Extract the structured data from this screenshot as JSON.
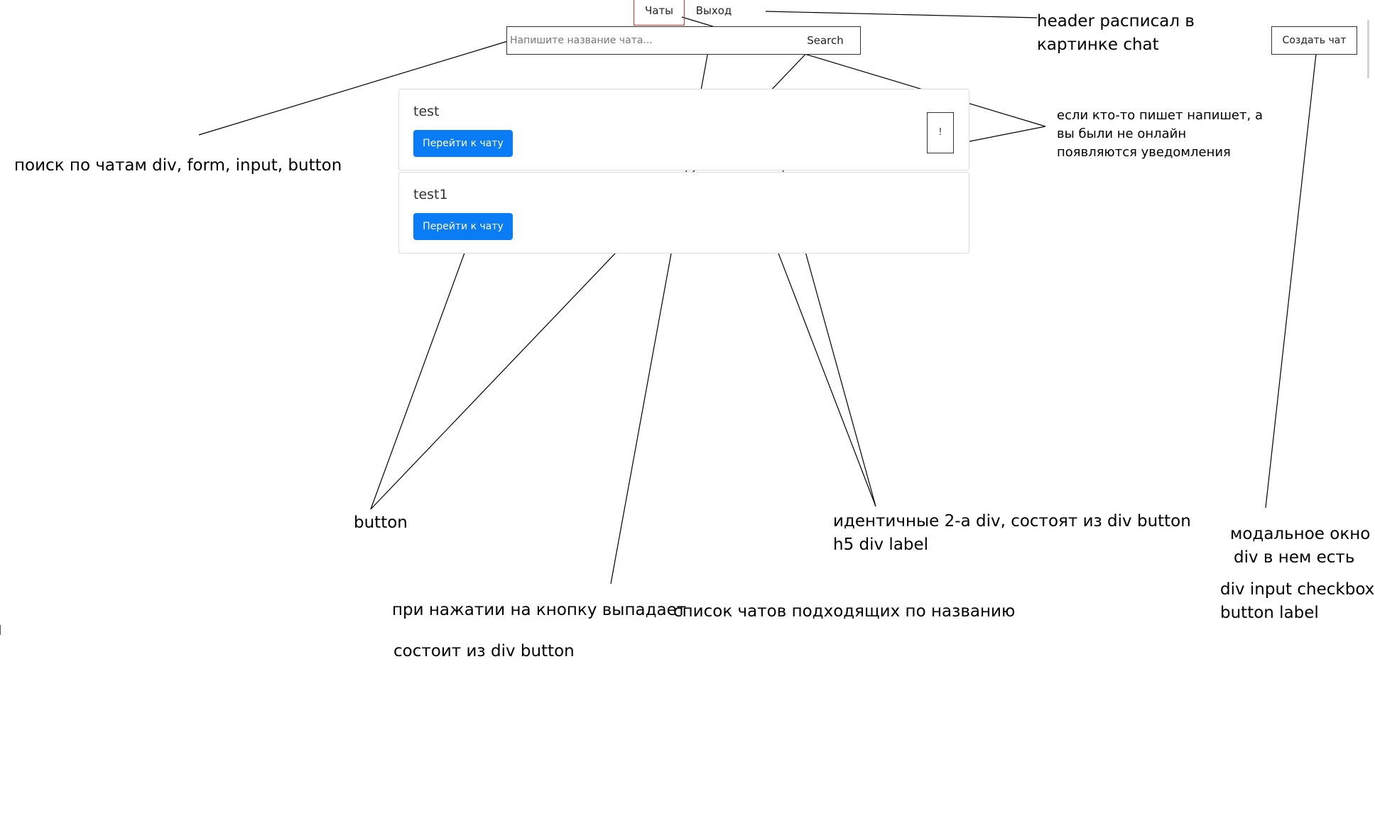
{
  "header": {
    "tabs": [
      {
        "label": "Чаты",
        "active": true
      },
      {
        "label": "Выход",
        "active": false
      }
    ]
  },
  "search": {
    "placeholder": "Напишите название чата...",
    "value": "",
    "button_label": "Search"
  },
  "create_chat": {
    "label": "Создать чат"
  },
  "chats": [
    {
      "title": "test",
      "button_label": "Перейти к чату",
      "notification": "!"
    },
    {
      "title": "test1",
      "button_label": "Перейти к чату",
      "notification": ""
    }
  ],
  "annotations": {
    "header_note": [
      "header расписал в",
      "картинке  chat"
    ],
    "search_note": "поиск по чатам div, form, input, button",
    "notify_note": [
      "если кто-то пишет напишет, а",
      "вы были не онлайн",
      "появляются уведомления"
    ],
    "button_note": "button",
    "cards_note": [
      "идентичные 2-а div, состоят из div button",
      "h5 div label"
    ],
    "dropdown_note_1": "при нажатии на кнопку выпадает",
    "dropdown_note_2": "список чатов подходящих по названию",
    "dropdown_note_3": "состоит из div button",
    "modal_note": [
      "модальное окно",
      "div    в нем есть",
      "div input checkbox",
      "button label"
    ]
  },
  "colors": {
    "primary_button": "#0a7cf5",
    "active_tab_border": "#e0302a",
    "card_border": "#dcdcdc"
  }
}
